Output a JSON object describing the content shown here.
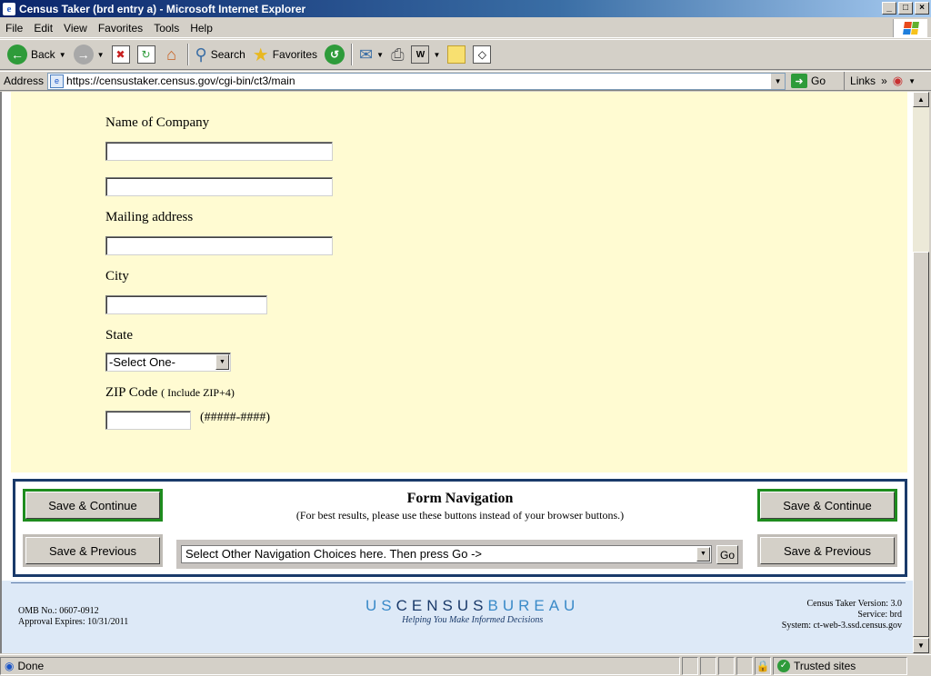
{
  "window": {
    "title": "Census Taker (brd entry a) - Microsoft Internet Explorer",
    "controls": [
      "_",
      "□",
      "×"
    ]
  },
  "menu": [
    "File",
    "Edit",
    "View",
    "Favorites",
    "Tools",
    "Help"
  ],
  "toolbar": {
    "back": "Back",
    "search": "Search",
    "favorites": "Favorites"
  },
  "address": {
    "label": "Address",
    "url": "https://censustaker.census.gov/cgi-bin/ct3/main",
    "go": "Go",
    "links": "Links",
    "links_chevron": "»"
  },
  "form": {
    "company_label": "Name of Company",
    "mailing_label": "Mailing address",
    "city_label": "City",
    "state_label": "State",
    "state_value": "-Select One-",
    "zip_label": "ZIP Code",
    "zip_note": "( Include ZIP+4)",
    "zip_hint": "(#####-####)"
  },
  "nav": {
    "title": "Form Navigation",
    "subtitle": "(For best results, please use these buttons instead of your browser buttons.)",
    "save_continue": "Save & Continue",
    "save_previous": "Save & Previous",
    "select_value": "Select Other Navigation Choices here. Then press Go ->",
    "go": "Go"
  },
  "footer": {
    "omb": "OMB No.: 0607-0912",
    "expires": "Approval Expires: 10/31/2011",
    "logo_us": "US",
    "logo_census": "CENSUS",
    "logo_bureau": "BUREAU",
    "tagline": "Helping You Make Informed Decisions",
    "version": "Census Taker Version: 3.0",
    "service": "Service: brd",
    "system": "System: ct-web-3.ssd.census.gov"
  },
  "status": {
    "text": "Done",
    "zone": "Trusted sites"
  },
  "colors": {
    "form_bg": "#fffbd2",
    "nav_border": "#1a3a6a",
    "continue_border": "#1e8c1e",
    "footer_bg": "#dde9f7"
  }
}
